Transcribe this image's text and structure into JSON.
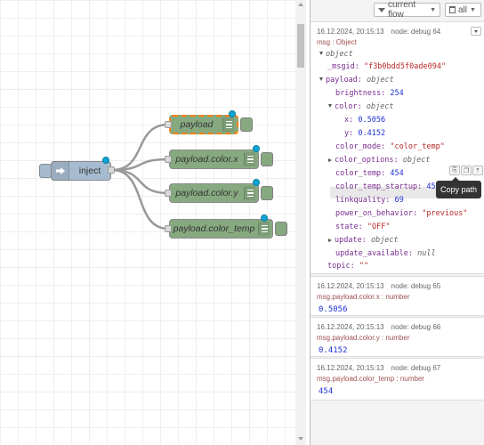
{
  "workspace": {
    "inject_node": {
      "label": "inject"
    },
    "debug_nodes": [
      {
        "label": "payload",
        "selected": true
      },
      {
        "label": "payload.color.x",
        "selected": false
      },
      {
        "label": "payload.color.y",
        "selected": false
      },
      {
        "label": "payload.color_temp",
        "selected": false
      }
    ],
    "colors": {
      "inject": "#a6bbcf",
      "debug": "#87a980",
      "selection": "#ff7f0e",
      "changed_dot": "#0ea4d4"
    }
  },
  "sidebar": {
    "toolbar": {
      "filter_label": "current flow",
      "clear_label": "all"
    },
    "messages": [
      {
        "timestamp": "16.12.2024, 20:15:13",
        "node": "node: debug 64",
        "topic": "msg : Object",
        "tree": {
          "root_type": "object",
          "rows": [
            {
              "key": "_msgid:",
              "value": "\"f3b0bdd5f0ade094\"",
              "kind": "str"
            },
            {
              "key": "payload:",
              "value": "object",
              "kind": "type"
            },
            {
              "key": "brightness:",
              "value": "254",
              "kind": "num"
            },
            {
              "key": "color:",
              "value": "object",
              "kind": "type"
            },
            {
              "key": "x:",
              "value": "0.5056",
              "kind": "num"
            },
            {
              "key": "y:",
              "value": "0.4152",
              "kind": "num"
            },
            {
              "key": "color_mode:",
              "value": "\"color_temp\"",
              "kind": "str"
            },
            {
              "key": "color_options:",
              "value": "object",
              "kind": "type"
            },
            {
              "key": "color_temp:",
              "value": "454",
              "kind": "num"
            },
            {
              "key": "color_temp_startup:",
              "value": "454",
              "kind": "num"
            },
            {
              "key": "linkquality:",
              "value": "69",
              "kind": "num"
            },
            {
              "key": "power_on_behavior:",
              "value": "\"previous\"",
              "kind": "str"
            },
            {
              "key": "state:",
              "value": "\"OFF\"",
              "kind": "str"
            },
            {
              "key": "update:",
              "value": "object",
              "kind": "type"
            },
            {
              "key": "update_available:",
              "value": "null",
              "kind": "nul"
            },
            {
              "key": "topic:",
              "value": "\"\"",
              "kind": "str"
            }
          ]
        },
        "tooltip": "Copy path"
      },
      {
        "timestamp": "16.12.2024, 20:15:13",
        "node": "node: debug 65",
        "topic": "msg.payload.color.x : number",
        "value": "0.5056"
      },
      {
        "timestamp": "16.12.2024, 20:15:13",
        "node": "node: debug 66",
        "topic": "msg.payload.color.y : number",
        "value": "0.4152"
      },
      {
        "timestamp": "16.12.2024, 20:15:13",
        "node": "node: debug 67",
        "topic": "msg.payload.color_temp : number",
        "value": "454"
      }
    ]
  }
}
